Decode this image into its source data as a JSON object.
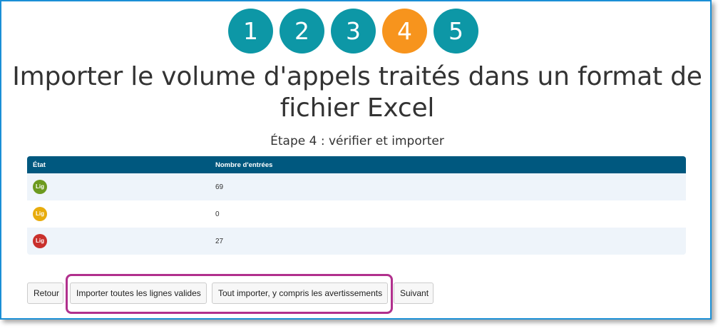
{
  "steps": [
    {
      "label": "1",
      "active": false
    },
    {
      "label": "2",
      "active": false
    },
    {
      "label": "3",
      "active": false
    },
    {
      "label": "4",
      "active": true
    },
    {
      "label": "5",
      "active": false
    }
  ],
  "colors": {
    "step": "#0d97a6",
    "step_active": "#f7941d",
    "table_header": "#00587f",
    "highlight": "#b1308d",
    "status_valid": "#6c9a1f",
    "status_warning": "#e8ac0d",
    "status_error": "#c9302c"
  },
  "title": "Importer le volume d'appels traités dans un format de fichier Excel",
  "subtitle": "Étape 4 : vérifier et importer",
  "table": {
    "headers": [
      "État",
      "Nombre d'entrées"
    ],
    "rows": [
      {
        "badge": "Lig",
        "status": "valid",
        "count": "69"
      },
      {
        "badge": "Lig",
        "status": "warning",
        "count": "0"
      },
      {
        "badge": "Lig",
        "status": "error",
        "count": "27"
      }
    ]
  },
  "buttons": {
    "back": "Retour",
    "import_valid": "Importer toutes les lignes valides",
    "import_all": "Tout importer, y compris les avertissements",
    "next": "Suivant"
  }
}
